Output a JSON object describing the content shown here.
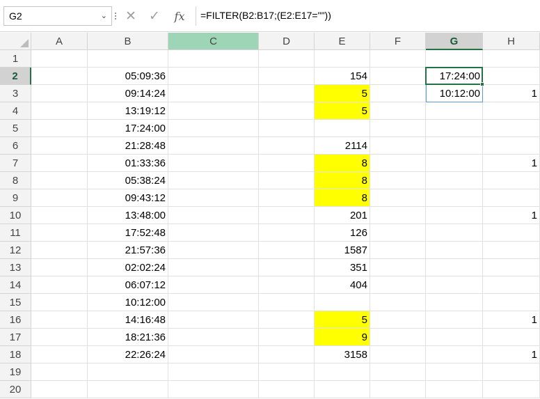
{
  "formula_bar": {
    "name_box": "G2",
    "formula": "=FILTER(B2:B17;(E2:E17=\"\"))",
    "icons": [
      "cancel-icon",
      "enter-icon",
      "fx-icon",
      "chevron-down-icon"
    ]
  },
  "columns": [
    "A",
    "B",
    "C",
    "D",
    "E",
    "F",
    "G",
    "H"
  ],
  "rows": [
    "1",
    "2",
    "3",
    "4",
    "5",
    "6",
    "7",
    "8",
    "9",
    "10",
    "11",
    "12",
    "13",
    "14",
    "15",
    "16",
    "17",
    "18",
    "19",
    "20"
  ],
  "active_cell": "G2",
  "colors": {
    "highlight": "#ffff00",
    "selection": "#217346",
    "header_bg": "#f3f3f3"
  },
  "cells": {
    "B": [
      "",
      "05:09:36",
      "09:14:24",
      "13:19:12",
      "17:24:00",
      "21:28:48",
      "01:33:36",
      "05:38:24",
      "09:43:12",
      "13:48:00",
      "17:52:48",
      "21:57:36",
      "02:02:24",
      "06:07:12",
      "10:12:00",
      "14:16:48",
      "18:21:36",
      "22:26:24",
      "",
      ""
    ],
    "E": [
      "",
      "154",
      "5",
      "5",
      "",
      "2114",
      "8",
      "8",
      "8",
      "201",
      "126",
      "1587",
      "351",
      "404",
      "",
      "5",
      "9",
      "3158",
      "",
      ""
    ],
    "G": [
      "",
      "17:24:00",
      "10:12:00",
      "",
      "",
      "",
      "",
      "",
      "",
      "",
      "",
      "",
      "",
      "",
      "",
      "",
      "",
      "",
      "",
      ""
    ],
    "H": [
      "",
      "",
      "1",
      "",
      "",
      "",
      "1",
      "",
      "",
      "1",
      "",
      "",
      "",
      "",
      "",
      "1",
      "",
      "1",
      "",
      ""
    ]
  },
  "highlighted_E_rows": [
    3,
    4,
    7,
    8,
    9,
    16,
    17
  ]
}
